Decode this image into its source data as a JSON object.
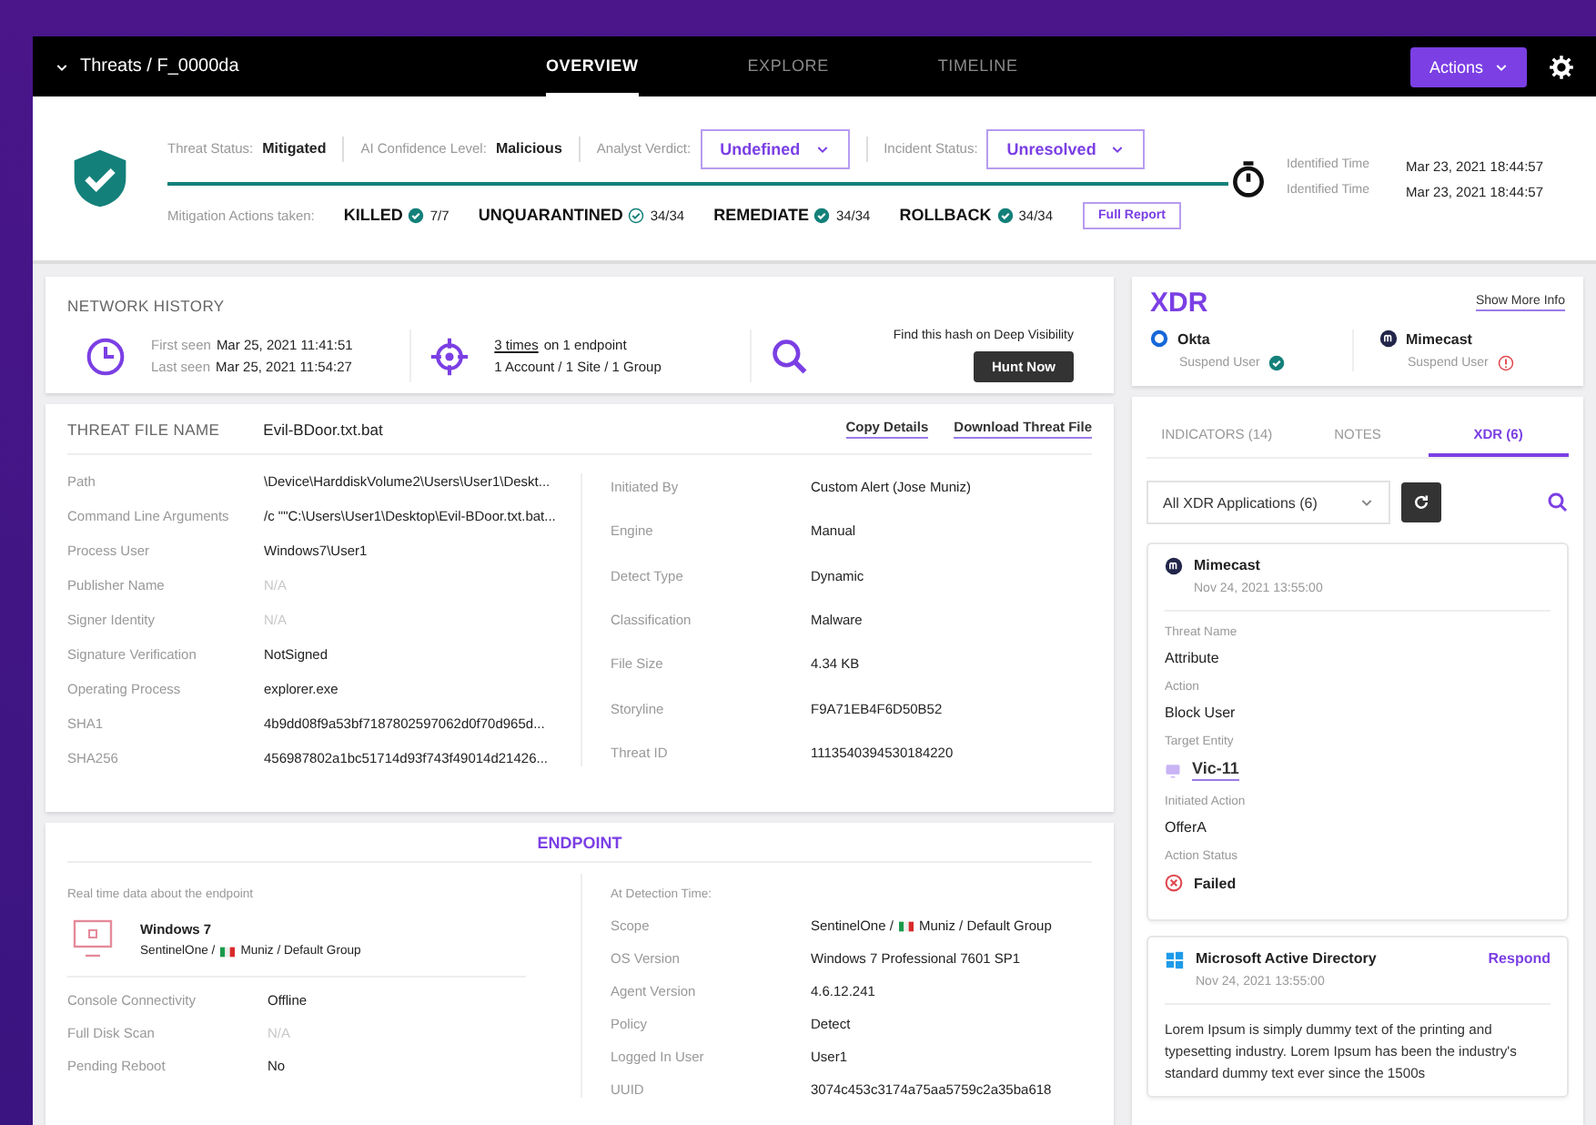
{
  "nav": {
    "breadcrumb": "Threats / F_0000da",
    "tabs": [
      {
        "label": "OVERVIEW",
        "selected": true
      },
      {
        "label": "EXPLORE",
        "selected": false
      },
      {
        "label": "TIMELINE",
        "selected": false
      }
    ],
    "actions_button": "Actions"
  },
  "header": {
    "statuses": [
      {
        "label": "Threat Status:",
        "value": "Mitigated"
      },
      {
        "label": "AI Confidence Level:",
        "value": "Malicious"
      }
    ],
    "dropdowns": [
      {
        "label": "Analyst Verdict:",
        "value": "Undefined"
      },
      {
        "label": "Incident Status:",
        "value": "Unresolved"
      }
    ],
    "mitigation_label": "Mitigation Actions taken:",
    "mitigations": [
      {
        "name": "KILLED",
        "count": "7/7",
        "kind": "filled"
      },
      {
        "name": "UNQUARANTINED",
        "count": "34/34",
        "kind": "outline"
      },
      {
        "name": "REMEDIATE",
        "count": "34/34",
        "kind": "filled"
      },
      {
        "name": "ROLLBACK",
        "count": "34/34",
        "kind": "filled"
      }
    ],
    "full_report": "Full Report",
    "times": [
      {
        "label": "Identified Time",
        "value": "Mar 23, 2021 18:44:57"
      },
      {
        "label": "Identified Time",
        "value": "Mar 23, 2021 18:44:57"
      }
    ]
  },
  "network_history": {
    "title": "NETWORK HISTORY",
    "first_label": "First seen",
    "first_value": "Mar 25, 2021 11:41:51",
    "last_label": "Last seen",
    "last_value": "Mar 25, 2021 11:54:27",
    "times_link": "3 times",
    "times_rest": "on 1 endpoint",
    "scope": "1 Account / 1 Site / 1 Group",
    "deep_text": "Find this hash on Deep Visibility",
    "hunt_button": "Hunt Now"
  },
  "threat_file": {
    "label": "THREAT FILE NAME",
    "name": "Evil-BDoor.txt.bat",
    "links": [
      "Copy Details",
      "Download Threat File"
    ],
    "left_rows": [
      {
        "label": "Path",
        "value": "\\Device\\HarddiskVolume2\\Users\\User1\\Deskt...",
        "muted": false
      },
      {
        "label": "Command Line Arguments",
        "value": "/c \"\"C:\\Users\\User1\\Desktop\\Evil-BDoor.txt.bat...",
        "muted": false
      },
      {
        "label": "Process User",
        "value": "Windows7\\User1",
        "muted": false
      },
      {
        "label": "Publisher Name",
        "value": "N/A",
        "muted": true
      },
      {
        "label": "Signer Identity",
        "value": "N/A",
        "muted": true
      },
      {
        "label": "Signature Verification",
        "value": "NotSigned",
        "muted": false
      },
      {
        "label": "Operating Process",
        "value": "explorer.exe",
        "muted": false
      },
      {
        "label": "SHA1",
        "value": "4b9dd08f9a53bf7187802597062d0f70d965d...",
        "muted": false
      },
      {
        "label": "SHA256",
        "value": "456987802a1bc51714d93f743f49014d21426...",
        "muted": false
      }
    ],
    "right_rows": [
      {
        "label": "Initiated By",
        "value": "Custom Alert (Jose Muniz)",
        "muted": false
      },
      {
        "label": "Engine",
        "value": "Manual",
        "muted": false
      },
      {
        "label": "Detect Type",
        "value": "Dynamic",
        "muted": false
      },
      {
        "label": "Classification",
        "value": "Malware",
        "muted": false
      },
      {
        "label": "File Size",
        "value": "4.34 KB",
        "muted": false
      },
      {
        "label": "Storyline",
        "value": "F9A71EB4F6D50B52",
        "muted": false
      },
      {
        "label": "Threat ID",
        "value": "1113540394530184220",
        "muted": false
      }
    ]
  },
  "endpoint": {
    "title": "ENDPOINT",
    "realtime_label": "Real time data about the endpoint",
    "device_name": "Windows 7",
    "device_site": "SentinelOne /",
    "device_group": "Muniz / Default Group",
    "rows": [
      {
        "label": "Console Connectivity",
        "value": "Offline",
        "muted": false
      },
      {
        "label": "Full Disk Scan",
        "value": "N/A",
        "muted": true
      },
      {
        "label": "Pending Reboot",
        "value": "No",
        "muted": false
      }
    ],
    "detection_label": "At Detection Time:",
    "scope_label": "Scope",
    "scope_site": "SentinelOne /",
    "scope_group": "Muniz / Default Group",
    "detection_rows": [
      {
        "label": "OS Version",
        "value": "Windows 7 Professional 7601 SP1"
      },
      {
        "label": "Agent Version",
        "value": "4.6.12.241"
      },
      {
        "label": "Policy",
        "value": "Detect"
      },
      {
        "label": "Logged In User",
        "value": "User1"
      },
      {
        "label": "UUID",
        "value": "3074c453c3174a75aa5759c2a35ba618"
      }
    ]
  },
  "xdr": {
    "title": "XDR",
    "show_more": "Show More Info",
    "integrations": [
      {
        "name": "Okta",
        "action": "Suspend User",
        "success": true,
        "kind": "ring"
      },
      {
        "name": "Mimecast",
        "action": "Suspend User",
        "success": false,
        "kind": "disc"
      }
    ]
  },
  "side_panel": {
    "tabs": [
      {
        "label": "INDICATORS (14)",
        "selected": false
      },
      {
        "label": "NOTES",
        "selected": false
      },
      {
        "label": "XDR (6)",
        "selected": true
      }
    ],
    "filter": "All XDR Applications (6)",
    "cards": [
      {
        "kind": "disc",
        "name": "Mimecast",
        "time": "Nov 24, 2021 13:55:00",
        "fields": [
          {
            "label": "Threat Name",
            "value": "Attribute",
            "kind": "text"
          },
          {
            "label": "Action",
            "value": "Block User",
            "kind": "text"
          },
          {
            "label": "Target Entity",
            "value": "Vic-11",
            "kind": "link"
          },
          {
            "label": "Initiated Action",
            "value": "OfferA",
            "kind": "text"
          },
          {
            "label": "Action Status",
            "value": "Failed",
            "kind": "status"
          }
        ]
      },
      {
        "kind": "windows",
        "name": "Microsoft Active Directory",
        "time": "Nov 24, 2021 13:55:00",
        "respond": "Respond",
        "body": "Lorem Ipsum is simply dummy text of the printing and typesetting industry. Lorem Ipsum has been the industry's standard dummy text ever since the 1500s"
      }
    ]
  }
}
